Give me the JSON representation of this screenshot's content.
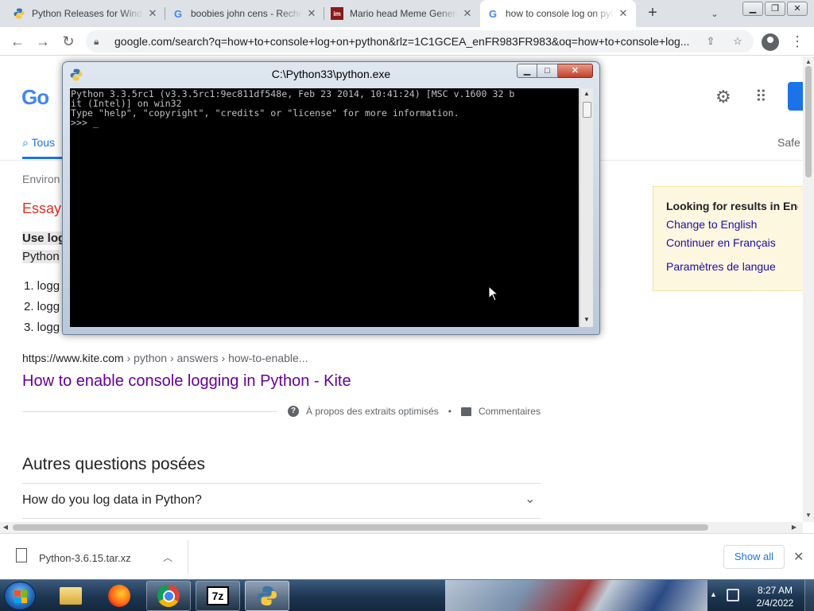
{
  "browser": {
    "tabs": [
      {
        "title": "Python Releases for Windows",
        "favicon": "python-icon"
      },
      {
        "title": "boobies john cens - Recherche",
        "favicon": "google-icon"
      },
      {
        "title": "Mario head Meme Generator",
        "favicon": "imgflip-icon"
      },
      {
        "title": "how to console log on python",
        "favicon": "google-icon",
        "active": true
      }
    ],
    "new_tab_label": "+",
    "url": "google.com/search?q=how+to+console+log+on+python&rlz=1C1GCEA_enFR983FR983&oq=how+to+console+log..."
  },
  "google": {
    "tab_all": "Tous",
    "safe": "Safe",
    "environ": "Environ",
    "essay": "Essay",
    "snippet_title": "Use log",
    "snippet_line2": "Python",
    "list": [
      "1. logg",
      "2. logg",
      "3. logg"
    ],
    "result_cite": "https://www.kite.com",
    "result_path": " › python › answers › how-to-enable...",
    "result_title": "How to enable console logging in Python - Kite",
    "apropos": "À propos des extraits optimisés",
    "bullet": "•",
    "feedback": "Commentaires",
    "paa_title": "Autres questions posées",
    "paa_question": "How do you log data in Python?"
  },
  "language_box": {
    "title": "Looking for results in English?",
    "change": "Change to English",
    "continue": "Continuer en Français",
    "settings": "Paramètres de langue"
  },
  "console": {
    "title": "C:\\Python33\\python.exe",
    "lines": "Python 3.3.5rc1 (v3.3.5rc1:9ec811df548e, Feb 23 2014, 10:41:24) [MSC v.1600 32 b\nit (Intel)] on win32\nType \"help\", \"copyright\", \"credits\" or \"license\" for more information.\n>>> _"
  },
  "downloads": {
    "file": "Python-3.6.15.tar.xz",
    "show_all": "Show all"
  },
  "taskbar": {
    "time": "8:27 AM",
    "date": "2/4/2022"
  },
  "colors": {
    "link": "#1a0dab",
    "visited": "#660099",
    "accent": "#1a73e8",
    "essay_red": "#d93025",
    "lang_box_bg": "#fef7e0"
  }
}
